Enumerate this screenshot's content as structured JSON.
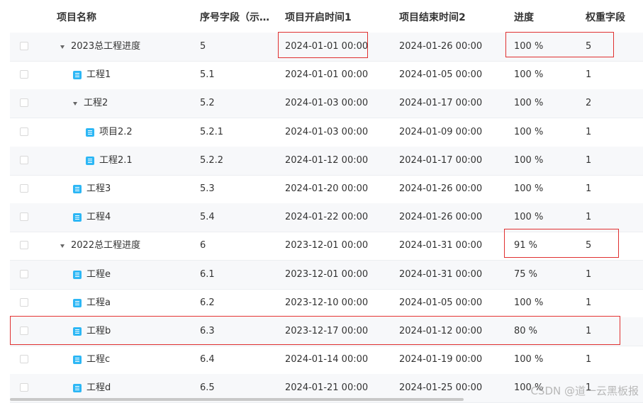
{
  "headers": {
    "name": "项目名称",
    "seq": "序号字段（示…",
    "start": "项目开启时间1",
    "end": "项目结束时间2",
    "progress": "进度",
    "weight": "权重字段"
  },
  "rows": [
    {
      "name": "2023总工程进度",
      "seq": "5",
      "start": "2024-01-01 00:00",
      "end": "2024-01-26 00:00",
      "progress": "100 %",
      "weight": "5",
      "level": 0,
      "expandable": true
    },
    {
      "name": "工程1",
      "seq": "5.1",
      "start": "2024-01-01 00:00",
      "end": "2024-01-05 00:00",
      "progress": "100 %",
      "weight": "1",
      "level": 1,
      "expandable": false
    },
    {
      "name": "工程2",
      "seq": "5.2",
      "start": "2024-01-03 00:00",
      "end": "2024-01-17 00:00",
      "progress": "100 %",
      "weight": "2",
      "level": 1,
      "expandable": true
    },
    {
      "name": "项目2.2",
      "seq": "5.2.1",
      "start": "2024-01-03 00:00",
      "end": "2024-01-09 00:00",
      "progress": "100 %",
      "weight": "1",
      "level": 2,
      "expandable": false
    },
    {
      "name": "工程2.1",
      "seq": "5.2.2",
      "start": "2024-01-12 00:00",
      "end": "2024-01-17 00:00",
      "progress": "100 %",
      "weight": "1",
      "level": 2,
      "expandable": false
    },
    {
      "name": "工程3",
      "seq": "5.3",
      "start": "2024-01-20 00:00",
      "end": "2024-01-26 00:00",
      "progress": "100 %",
      "weight": "1",
      "level": 1,
      "expandable": false
    },
    {
      "name": "工程4",
      "seq": "5.4",
      "start": "2024-01-22 00:00",
      "end": "2024-01-26 00:00",
      "progress": "100 %",
      "weight": "1",
      "level": 1,
      "expandable": false
    },
    {
      "name": "2022总工程进度",
      "seq": "6",
      "start": "2023-12-01 00:00",
      "end": "2024-01-31 00:00",
      "progress": "91 %",
      "weight": "5",
      "level": 0,
      "expandable": true
    },
    {
      "name": "工程e",
      "seq": "6.1",
      "start": "2023-12-01 00:00",
      "end": "2024-01-31 00:00",
      "progress": "75 %",
      "weight": "1",
      "level": 1,
      "expandable": false
    },
    {
      "name": "工程a",
      "seq": "6.2",
      "start": "2023-12-10 00:00",
      "end": "2024-01-05 00:00",
      "progress": "100 %",
      "weight": "1",
      "level": 1,
      "expandable": false
    },
    {
      "name": "工程b",
      "seq": "6.3",
      "start": "2023-12-17 00:00",
      "end": "2024-01-12 00:00",
      "progress": "80 %",
      "weight": "1",
      "level": 1,
      "expandable": false
    },
    {
      "name": "工程c",
      "seq": "6.4",
      "start": "2024-01-14 00:00",
      "end": "2024-01-19 00:00",
      "progress": "100 %",
      "weight": "1",
      "level": 1,
      "expandable": false
    },
    {
      "name": "工程d",
      "seq": "6.5",
      "start": "2024-01-21 00:00",
      "end": "2024-01-25 00:00",
      "progress": "100 %",
      "weight": "1",
      "level": 1,
      "expandable": false
    }
  ],
  "watermark": "CSDN @道一云黑板报",
  "colors": {
    "highlight": "#e03030",
    "doc_icon": "#2db7f5",
    "alt_row": "#f7f8fa"
  }
}
